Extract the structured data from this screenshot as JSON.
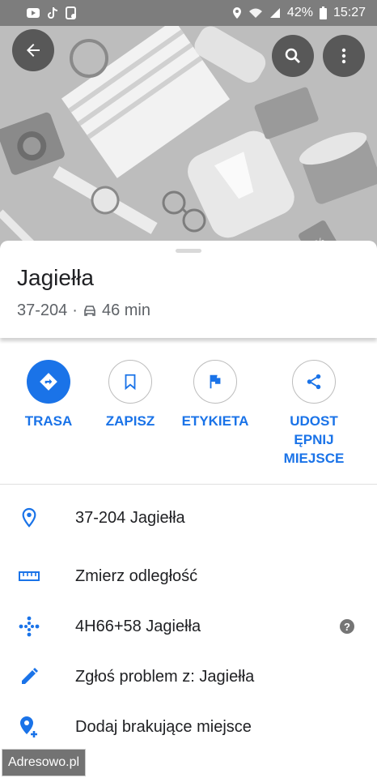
{
  "status_bar": {
    "battery": "42%",
    "time": "15:27"
  },
  "place": {
    "name": "Jagiełła",
    "postcode": "37-204",
    "separator": "·",
    "drive_time": "46 min"
  },
  "actions": [
    {
      "label": "TRASA",
      "icon": "directions-icon"
    },
    {
      "label": "ZAPISZ",
      "icon": "bookmark-icon"
    },
    {
      "label": "ETYKIETA",
      "icon": "flag-icon"
    },
    {
      "label": "UDOST\nĘPNIJ\nMIEJSCE",
      "icon": "share-icon"
    }
  ],
  "details": [
    {
      "text": "37-204 Jagiełła",
      "icon": "location-pin-icon"
    },
    {
      "text": "Zmierz odległość",
      "icon": "ruler-icon"
    },
    {
      "text": "4H66+58 Jagiełła",
      "icon": "plus-code-icon",
      "help": "?"
    },
    {
      "text": "Zgłoś problem z: Jagiełła",
      "icon": "pencil-icon"
    },
    {
      "text": "Dodaj brakujące miejsce",
      "icon": "add-place-icon"
    }
  ],
  "watermark": "Adresowo.pl",
  "colors": {
    "accent": "#1a73e8",
    "text": "#202124",
    "secondary": "#5f6368"
  }
}
